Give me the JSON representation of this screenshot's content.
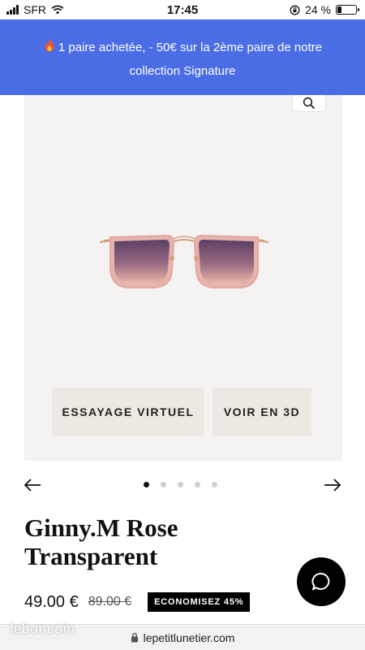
{
  "status_bar": {
    "carrier": "SFR",
    "time": "17:45",
    "battery_text": "24 %",
    "battery_level": 0.24
  },
  "promo": {
    "icon": "fire-icon",
    "text": "1 paire achetée, - 50€ sur la 2ème paire de notre collection Signature"
  },
  "product": {
    "image_alt_icon": "sunglasses-image",
    "zoom_icon": "search-icon",
    "buttons": {
      "virtual_tryon": "ESSAYAGE VIRTUEL",
      "view_3d": "VOIR EN 3D"
    },
    "carousel": {
      "total": 5,
      "active": 1,
      "prev_icon": "arrow-left-icon",
      "next_icon": "arrow-right-icon"
    },
    "title": "Ginny.M Rose Transparent",
    "price": "49.00 €",
    "old_price": "89.00 €",
    "badge": "ECONOMISEZ 45%"
  },
  "chat": {
    "icon": "chat-bubble-icon"
  },
  "browser": {
    "url": "lepetitlunetier.com",
    "lock_icon": "lock-icon"
  },
  "watermark": "leboncoin",
  "colors": {
    "promo_bg": "#4a6de5",
    "card_bg": "#f4f3f1",
    "button_bg": "#ece8e2",
    "badge_bg": "#000000"
  }
}
